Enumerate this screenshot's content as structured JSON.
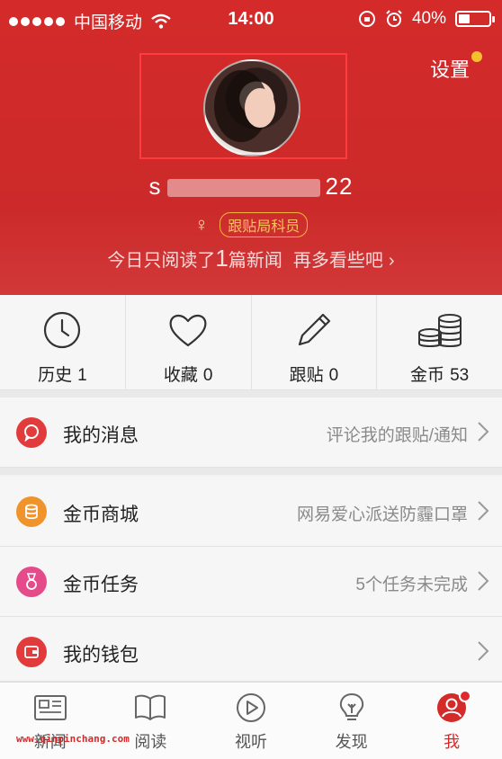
{
  "status_bar": {
    "carrier": "中国移动",
    "time": "14:00",
    "battery": "40%"
  },
  "profile": {
    "settings_label": "设置",
    "username_prefix": "s",
    "username_suffix": "22",
    "gender_symbol": "♀",
    "rank": "跟贴局科员",
    "today_prefix": "今日只阅读了",
    "today_count": "1",
    "today_suffix": "篇新闻",
    "today_more": "再多看些吧",
    "chevron": "›"
  },
  "stats": [
    {
      "label": "历史",
      "value": "1",
      "icon": "clock-icon"
    },
    {
      "label": "收藏",
      "value": "0",
      "icon": "heart-icon"
    },
    {
      "label": "跟贴",
      "value": "0",
      "icon": "pencil-icon"
    },
    {
      "label": "金币",
      "value": "53",
      "icon": "coins-icon"
    }
  ],
  "menu": [
    {
      "title": "我的消息",
      "subtitle": "评论我的跟贴/通知",
      "icon": "message-icon",
      "color": "#e23b3b"
    },
    {
      "title": "金币商城",
      "subtitle": "网易爱心派送防霾口罩",
      "icon": "coin-store-icon",
      "color": "#f0932b"
    },
    {
      "title": "金币任务",
      "subtitle": "5个任务未完成",
      "icon": "medal-icon",
      "color": "#e54b8a"
    },
    {
      "title": "我的钱包",
      "subtitle": "",
      "icon": "wallet-icon",
      "color": "#e23b3b"
    }
  ],
  "tabs": [
    {
      "label": "新闻",
      "icon": "newspaper-icon"
    },
    {
      "label": "阅读",
      "icon": "book-icon"
    },
    {
      "label": "视听",
      "icon": "play-icon"
    },
    {
      "label": "发现",
      "icon": "bulb-icon"
    },
    {
      "label": "我",
      "icon": "user-icon"
    }
  ],
  "watermark": "www.qinpinchang.com",
  "colors": {
    "brand_red": "#d42a2a",
    "rank_gold": "#f4b63a",
    "settings_dot": "#f5c02e"
  }
}
